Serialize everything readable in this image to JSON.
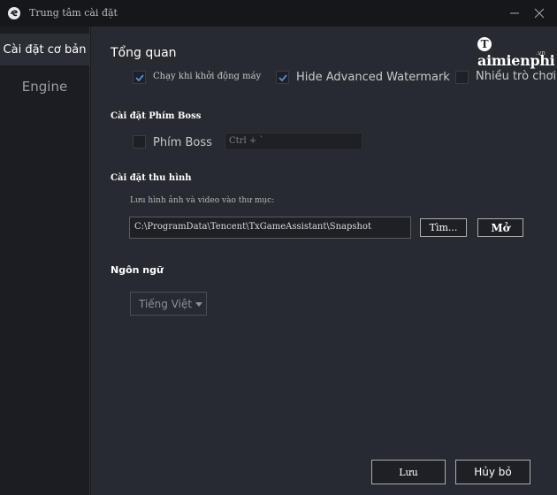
{
  "window": {
    "title": "Trung tâm cài đặt",
    "minimize_icon": "minimize-icon",
    "close_icon": "close-icon"
  },
  "sidebar": {
    "items": [
      {
        "label": "Cài đặt cơ bản",
        "active": true
      },
      {
        "label": "Engine",
        "active": false
      }
    ]
  },
  "watermark": {
    "brand": "aimienphi",
    "brand_initial": "T",
    "suffix": ".vn"
  },
  "overview": {
    "heading": "Tổng quan",
    "options": [
      {
        "label": "Chạy khi khởi động máy",
        "checked": true
      },
      {
        "label": "Hide Advanced Watermark",
        "checked": true
      },
      {
        "label": "Nhiều trò chơi",
        "checked": false
      }
    ]
  },
  "boss_key": {
    "heading": "Cài đặt Phím Boss",
    "checkbox_label": "Phím Boss",
    "checked": false,
    "hotkey_value": "Ctrl + `"
  },
  "capture": {
    "heading": "Cài đặt thu hình",
    "folder_label": "Lưu hình ảnh và video vào thư mục:",
    "path_value": "C:\\ProgramData\\Tencent\\TxGameAssistant\\Snapshot",
    "browse_label": "Tìm...",
    "open_label": "Mở"
  },
  "language": {
    "heading": "Ngôn ngữ",
    "selected": "Tiếng Việt"
  },
  "footer": {
    "save_label": "Lưu",
    "cancel_label": "Hủy bỏ"
  },
  "colors": {
    "accent_check": "#4a90e2",
    "content_bg": "#272a30",
    "sidebar_bg": "#1b1d22"
  }
}
